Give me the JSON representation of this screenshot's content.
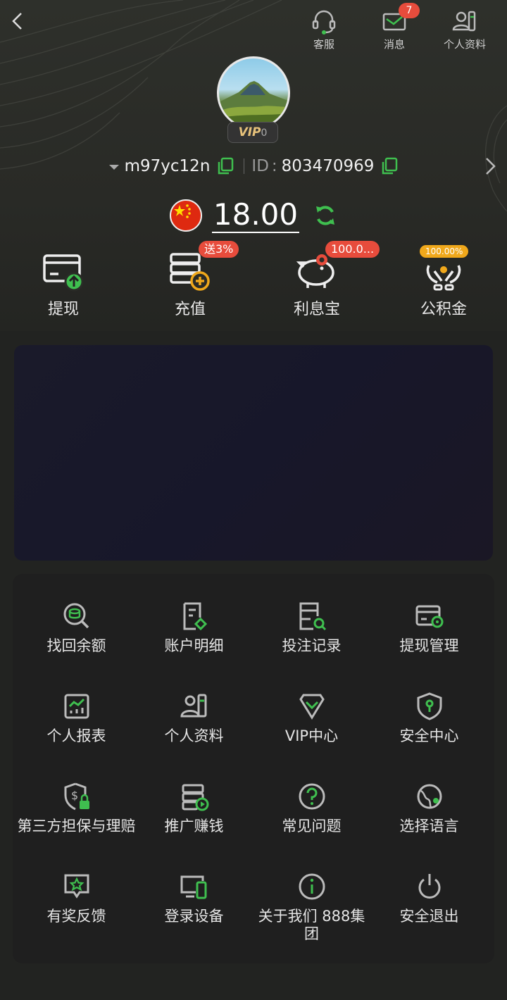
{
  "colors": {
    "accent": "#3fbf4f",
    "badge": "#e74c3c",
    "gold": "#f0a81b",
    "background": "#222321"
  },
  "top_nav": {
    "support": "客服",
    "messages": "消息",
    "messages_badge": "7",
    "profile": "个人资料"
  },
  "user": {
    "vip_label": "VIP",
    "vip_level": "0",
    "username": "m97yc12n",
    "id_label": "ID",
    "id_value": "803470969"
  },
  "balance": {
    "amount": "18.00",
    "currency_flag": "china-flag-icon"
  },
  "quick_actions": [
    {
      "label": "提现",
      "icon": "withdraw-card-icon"
    },
    {
      "label": "充值",
      "icon": "deposit-plus-icon",
      "tag": "送3%"
    },
    {
      "label": "利息宝",
      "icon": "piggy-bank-icon",
      "tag": "100.0..."
    },
    {
      "label": "公积金",
      "icon": "fund-hands-icon",
      "tag": "100.00%"
    }
  ],
  "menu": [
    {
      "label": "找回余额",
      "icon": "recover-balance-icon"
    },
    {
      "label": "账户明细",
      "icon": "account-details-icon"
    },
    {
      "label": "投注记录",
      "icon": "bet-records-icon"
    },
    {
      "label": "提现管理",
      "icon": "withdraw-manage-icon"
    },
    {
      "label": "个人报表",
      "icon": "report-chart-icon"
    },
    {
      "label": "个人资料",
      "icon": "profile-card-icon"
    },
    {
      "label": "VIP中心",
      "icon": "vip-diamond-icon"
    },
    {
      "label": "安全中心",
      "icon": "security-shield-icon"
    },
    {
      "label": "第三方担保与理赔",
      "icon": "guarantee-shield-icon"
    },
    {
      "label": "推广赚钱",
      "icon": "promote-earn-icon"
    },
    {
      "label": "常见问题",
      "icon": "faq-question-icon"
    },
    {
      "label": "选择语言",
      "icon": "language-globe-icon"
    },
    {
      "label": "有奖反馈",
      "icon": "feedback-star-icon"
    },
    {
      "label": "登录设备",
      "icon": "login-devices-icon"
    },
    {
      "label": "关于我们 888集团",
      "icon": "about-info-icon"
    },
    {
      "label": "安全退出",
      "icon": "logout-power-icon"
    }
  ]
}
